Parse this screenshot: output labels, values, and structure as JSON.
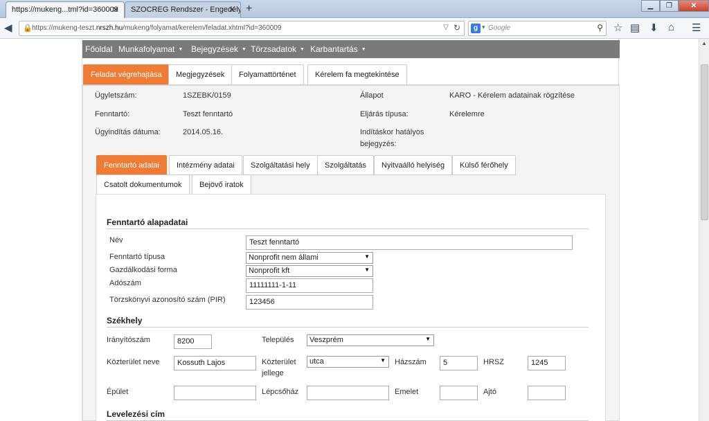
{
  "browser": {
    "tabs": [
      {
        "label": "https://mukeng...tml?id=360009"
      },
      {
        "label": "SZOCREG Rendszer - Engedély ..."
      }
    ],
    "url_prefix": "https://mukeng-teszt.",
    "url_host": "nrszh.hu",
    "url_path": "/mukeng/folyamat/kerelem/feladat.xhtml?id=360009",
    "search_placeholder": "Google"
  },
  "menu": {
    "items": [
      {
        "label": "Főoldal"
      },
      {
        "label": "Munkafolyamat"
      },
      {
        "label": "Bejegyzések"
      },
      {
        "label": "Törzsadatok"
      },
      {
        "label": "Karbantartás"
      }
    ]
  },
  "main_tabs": [
    {
      "label": "Feladat végrehajtása",
      "active": true
    },
    {
      "label": "Megjegyzések"
    },
    {
      "label": "Folyamattörténet"
    },
    {
      "label": "Kérelem fa megtekintése"
    }
  ],
  "case_info": {
    "ugyletszam_label": "Ügyletszám:",
    "ugyletszam": "1SZEBK/0159",
    "fenntarto_label": "Fenntartó:",
    "fenntarto": "Teszt fenntartó",
    "datum_label": "Ügyindítás dátuma:",
    "datum": "2014.05.16.",
    "allapot_label": "Állapot",
    "allapot": "KARO - Kérelem adatainak rögzítése",
    "eljaras_label": "Eljárás típusa:",
    "eljaras": "Kérelemre",
    "inditaskor_label": "Indításkor hatályos",
    "inditaskor_label2": "bejegyzés:"
  },
  "sub_tabs": [
    {
      "label": "Fenntartó adatai",
      "active": true
    },
    {
      "label": "Intézmény adatai"
    },
    {
      "label": "Szolgáltatási hely"
    },
    {
      "label": "Szolgáltatás"
    },
    {
      "label": "Nyitvaálló helyiség"
    },
    {
      "label": "Külső férőhely"
    },
    {
      "label": "Csatolt dokumentumok"
    },
    {
      "label": "Bejövő iratok"
    }
  ],
  "form": {
    "alapadatok_title": "Fenntartó alapadatai",
    "nev_label": "Név",
    "nev_value": "Teszt fenntartó",
    "tipus_label": "Fenntartó típusa",
    "tipus_value": "Nonprofit nem állami",
    "gazd_label": "Gazdálkodási forma",
    "gazd_value": "Nonprofit kft",
    "adoszam_label": "Adószám",
    "adoszam_value": "11111111-1-11",
    "pir_label": "Törzskönyvi azonosító szám (PIR)",
    "pir_value": "123456",
    "szekhely_title": "Székhely",
    "irsz_label": "Irányítószám",
    "irsz_value": "8200",
    "telepules_label": "Település",
    "telepules_value": "Veszprém",
    "kozterulet_label": "Közterület neve",
    "kozterulet_value": "Kossuth Lajos",
    "jelleg_label": "Közterület",
    "jelleg_label2": "jellege",
    "jelleg_value": "utca",
    "hazszam_label": "Házszám",
    "hazszam_value": "5",
    "hrsz_label": "HRSZ",
    "hrsz_value": "1245",
    "epulet_label": "Épület",
    "lepcsohaz_label": "Lépcsőház",
    "emelet_label": "Emelet",
    "ajto_label": "Ajtó",
    "levelezesi_title": "Levelezési cím"
  }
}
